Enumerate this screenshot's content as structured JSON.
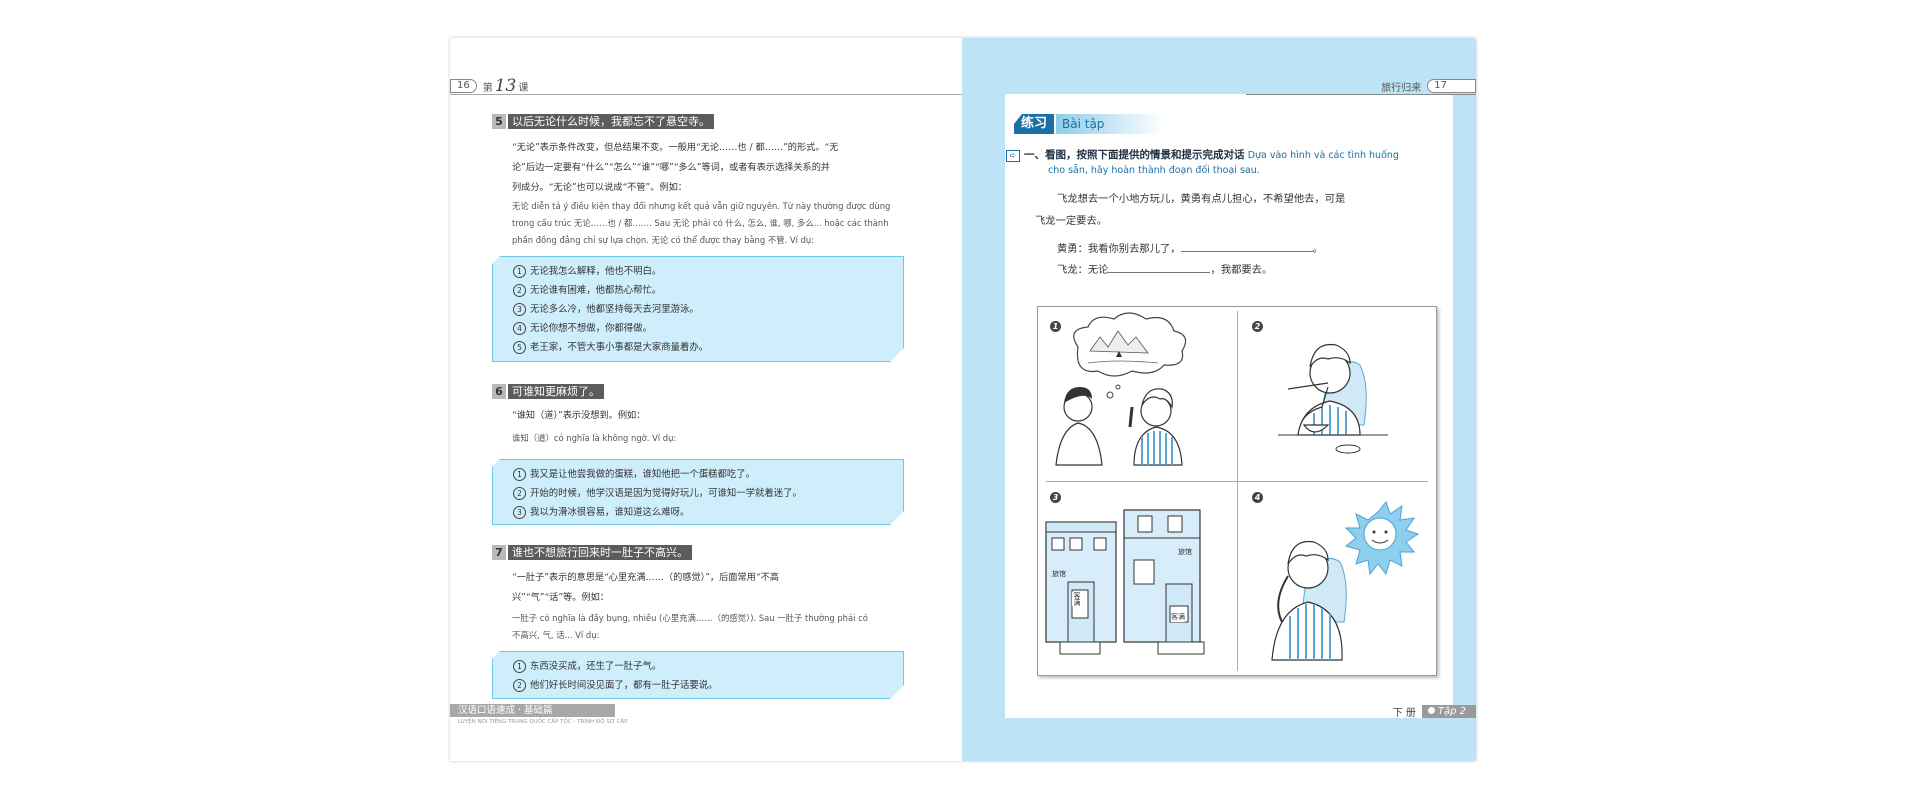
{
  "left_page": {
    "page_number": "16",
    "lesson_prefix": "第",
    "lesson_number": "13",
    "lesson_suffix": "课",
    "sections": [
      {
        "number": "5",
        "title": "以后无论什么时候，我都忘不了悬空寺。",
        "zh_lines": [
          "“无论”表示条件改变，但总结果不变。一般用“无论……也 / 都……”的形式。“无",
          "论”后边一定要有“什么”“怎么”“谁”“哪”“多么”等词，或者有表示选择关系的并",
          "列成分。“无论”也可以说成“不管”。例如："
        ],
        "vi_lines": [
          "无论 diễn tả ý điều kiện thay đổi nhưng kết quả vẫn giữ nguyên. Từ này thường được dùng",
          "trong cấu trúc 无论……也 / 都……. Sau 无论 phải có 什么, 怎么, 谁, 哪, 多么... hoặc các thành",
          "phần đồng đẳng chỉ sự lựa chọn. 无论 có thể được thay bằng 不管. Ví dụ:"
        ],
        "examples": [
          "无论我怎么解释，他也不明白。",
          "无论谁有困难，他都热心帮忙。",
          "无论多么冷，他都坚持每天去河里游泳。",
          "无论你想不想做，你都得做。",
          "老王家，不管大事小事都是大家商量着办。"
        ]
      },
      {
        "number": "6",
        "title": "可谁知更麻烦了。",
        "zh_lines": [
          "“谁知（道）”表示没想到。例如："
        ],
        "vi_lines": [
          "谁知（道）có nghĩa là không ngờ. Ví dụ:"
        ],
        "examples": [
          "我又是让他尝我做的蛋糕，谁知他把一个蛋糕都吃了。",
          "开始的时候，他学汉语是因为觉得好玩儿，可谁知一学就着迷了。",
          "我以为滑冰很容易，谁知道这么难呀。"
        ]
      },
      {
        "number": "7",
        "title": "谁也不想旅行回来时一肚子不高兴。",
        "zh_lines": [
          "“一肚子”表示的意思是“心里充满……（的感觉）”，后面常用“不高",
          "兴”“气”“话”等。例如："
        ],
        "vi_lines": [
          "一肚子 có nghĩa là đầy bụng, nhiều (心里充满……（的感觉）). Sau 一肚子 thường phải có",
          "不高兴, 气, 话... Ví dụ:"
        ],
        "examples": [
          "东西没买成，还生了一肚子气。",
          "他们好长时间没见面了，都有一肚子话要说。"
        ]
      }
    ],
    "footer_title": "汉语口语速成 · 基础篇",
    "footer_subtitle": "LUYỆN NÓI TIẾNG TRUNG QUỐC CẤP TỐC - TRÌNH ĐỘ SƠ CẤP"
  },
  "right_page": {
    "header_title": "旅行归来",
    "page_number": "17",
    "exercise_zh": "练习",
    "exercise_vi": "Bài tập",
    "task_number": "一、",
    "task_zh": "看图，按照下面提供的情景和提示完成对话",
    "task_vi_1": "Dựa vào hình và các tình huống",
    "task_vi_2": "cho sẵn, hãy hoàn thành đoạn đối thoại sau.",
    "scenario_1": "飞龙想去一个小地方玩儿，黄勇有点儿担心，不希望他去，可是",
    "scenario_2": "飞龙一定要去。",
    "dialog_1_speaker": "黄勇：我看你别去那儿了，",
    "dialog_1_end": "。",
    "dialog_2_speaker": "飞龙：无论",
    "dialog_2_end": "，我都要去。",
    "picture_numbers": [
      "1",
      "2",
      "3",
      "4"
    ],
    "sign_hotel": "旅馆",
    "sign_full": "客满",
    "footer_volume": "下 册",
    "footer_tap": "Tập 2"
  },
  "colors": {
    "right_page_bg": "#bde3f6",
    "example_box_bg": "#cfeefb",
    "example_box_border": "#6ec6e8",
    "exercise_badge": "#1b6fa7",
    "section_title_bg": "#5c5c5c"
  }
}
